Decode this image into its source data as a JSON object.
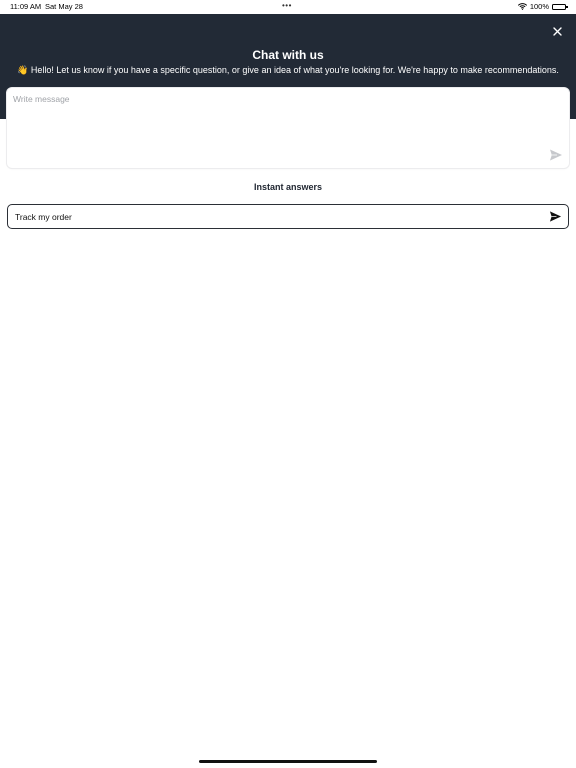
{
  "status_bar": {
    "time": "11:09 AM",
    "date": "Sat May 28",
    "battery": "100%",
    "icons": [
      "wifi-icon",
      "battery-icon"
    ]
  },
  "header": {
    "title": "Chat with us",
    "subtitle": "👋 Hello! Let us know if you have a specific question, or give an idea of what you're looking for. We're happy to make recommendations.",
    "close_icon": "close-icon",
    "background": "#222a36"
  },
  "composer": {
    "placeholder": "Write message",
    "value": "",
    "send_icon": "send-icon"
  },
  "instant_answers": {
    "title": "Instant answers",
    "items": [
      {
        "label": "Track my order",
        "icon": "send-icon"
      }
    ]
  }
}
